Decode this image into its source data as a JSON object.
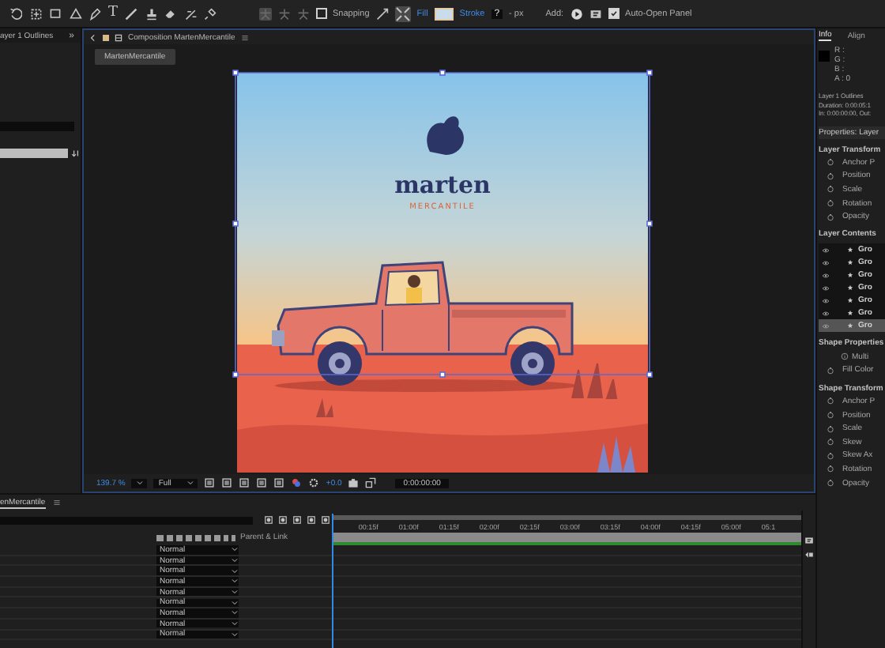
{
  "toolbar": {
    "text_tool": "T",
    "snapping": {
      "label": "Snapping",
      "checked": false
    },
    "fill": {
      "label": "Fill"
    },
    "stroke": {
      "label": "Stroke",
      "value": "?",
      "unit": "- px"
    },
    "add": {
      "label": "Add:"
    },
    "auto_open": {
      "label": "Auto-Open Panel",
      "checked": true
    }
  },
  "left_panel": {
    "title": "ayer 1 Outlines",
    "expand": "»"
  },
  "composition": {
    "title": "Composition MartenMercantile",
    "breadcrumb": "MartenMercantile",
    "artwork": {
      "brand": "marten",
      "tagline": "MERCANTILE"
    },
    "zoom": "139.7 %",
    "resolution": "Full",
    "exposure": "+0.0",
    "timecode": "0:00:00:00"
  },
  "info_panel": {
    "tabs": [
      {
        "label": "Info",
        "selected": true
      },
      {
        "label": "Align",
        "selected": false
      }
    ],
    "channels": [
      "R :",
      "G :",
      "B :",
      "A : 0"
    ],
    "layer_name": "Layer 1 Outlines",
    "duration": "Duration: 0:00:05:1",
    "in_out": "In: 0:00:00:00, Out:"
  },
  "properties_panel": {
    "title": "Properties: Layer",
    "sections": [
      {
        "title": "Layer Transform",
        "kind": "properties",
        "items": [
          {
            "label": "Anchor P",
            "kind": "stopwatch"
          },
          {
            "label": "Position",
            "kind": "stopwatch"
          },
          {
            "label": "Scale",
            "kind": "stopwatch"
          },
          {
            "label": "Rotation",
            "kind": "stopwatch"
          },
          {
            "label": "Opacity",
            "kind": "stopwatch"
          }
        ]
      },
      {
        "title": "Layer Contents",
        "kind": "layers",
        "items": [
          {
            "label": "Gro",
            "selected": false
          },
          {
            "label": "Gro",
            "selected": false
          },
          {
            "label": "Gro",
            "selected": false
          },
          {
            "label": "Gro",
            "selected": false
          },
          {
            "label": "Gro",
            "selected": false
          },
          {
            "label": "Gro",
            "selected": false
          },
          {
            "label": "Gro",
            "selected": true
          }
        ]
      },
      {
        "title": "Shape Properties",
        "kind": "properties",
        "items": [
          {
            "label": "Multi",
            "kind": "info"
          },
          {
            "label": "Fill Color",
            "kind": "stopwatch"
          }
        ]
      },
      {
        "title": "Shape Transform",
        "kind": "properties",
        "items": [
          {
            "label": "Anchor P",
            "kind": "stopwatch"
          },
          {
            "label": "Position",
            "kind": "stopwatch"
          },
          {
            "label": "Scale",
            "kind": "stopwatch"
          },
          {
            "label": "Skew",
            "kind": "stopwatch"
          },
          {
            "label": "Skew Ax",
            "kind": "stopwatch"
          },
          {
            "label": "Rotation",
            "kind": "stopwatch"
          },
          {
            "label": "Opacity",
            "kind": "stopwatch"
          }
        ]
      }
    ]
  },
  "timeline": {
    "tab": "enMercantile",
    "column_header": "Parent & Link",
    "layers": [
      {
        "mode": "Normal"
      },
      {
        "mode": "Normal"
      },
      {
        "mode": "Normal"
      },
      {
        "mode": "Normal"
      },
      {
        "mode": "Normal"
      },
      {
        "mode": "Normal"
      },
      {
        "mode": "Normal"
      },
      {
        "mode": "Normal"
      },
      {
        "mode": "Normal"
      }
    ],
    "ruler": [
      "00:15f",
      "01:00f",
      "01:15f",
      "02:00f",
      "02:15f",
      "03:00f",
      "03:15f",
      "04:00f",
      "04:15f",
      "05:00f",
      "05:1"
    ]
  }
}
